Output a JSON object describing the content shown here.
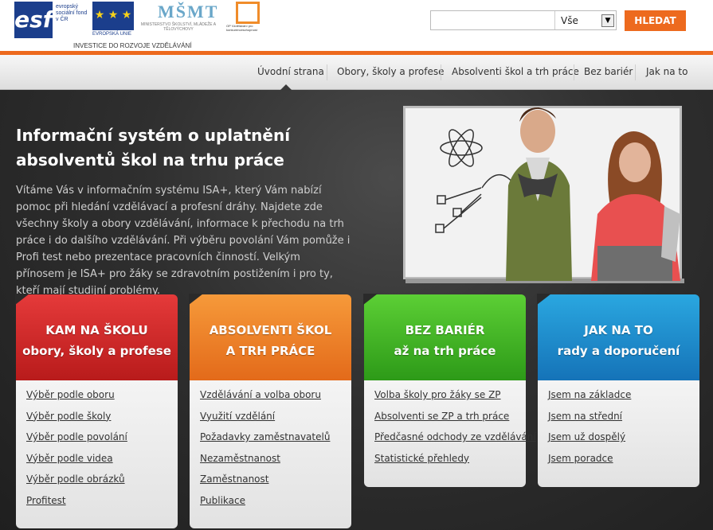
{
  "header": {
    "esf_text": "evropský sociální fond v ČR",
    "eu_caption": "EVROPSKÁ UNIE",
    "msmt_caption": "MINISTERSTVO ŠKOLSTVÍ, MLÁDEŽE A TĚLOVÝCHOVY",
    "op_caption": "OP Vzdělávání pro konkurenceschopnost",
    "invest_text": "INVESTICE DO ROZVOJE VZDĚLÁVÁNÍ",
    "search": {
      "value": "",
      "select_value": "Vše",
      "button_label": "HLEDAT"
    }
  },
  "nav": {
    "items": [
      "Úvodní strana",
      "Obory, školy a profese",
      "Absolventi škol a trh práce",
      "Bez bariér",
      "Jak na to"
    ]
  },
  "hero": {
    "title": "Informační systém o uplatnění absolventů škol na trhu práce",
    "text": "Vítáme Vás v informačním systému ISA+, který Vám nabízí pomoc při hledání vzdělávací a profesní dráhy. Najdete zde všechny školy a obory vzdělávání, informace k přechodu na trh práce i do dalšího vzdělávání. Při výběru povolání Vám pomůže i Profi test nebo prezentace pracovních činností. Velkým přínosem je ISA+ pro žáky se zdravotním postižením i pro ty, kteří mají studijní problémy."
  },
  "cards": [
    {
      "title1": "KAM NA ŠKOLU",
      "title2": "obory, školy a profese",
      "links": [
        "Výběr podle oboru",
        "Výběr podle školy",
        "Výběr podle povolání",
        "Výběr podle videa",
        "Výběr podle obrázků",
        "Profitest"
      ]
    },
    {
      "title1": "ABSOLVENTI ŠKOL",
      "title2": "A TRH PRÁCE",
      "links": [
        "Vzdělávání a volba oboru",
        "Využití vzdělání",
        "Požadavky zaměstnavatelů",
        "Nezaměstnanost",
        "Zaměstnanost",
        "Publikace"
      ]
    },
    {
      "title1": "BEZ BARIÉR",
      "title2": "až na trh práce",
      "links": [
        "Volba školy pro žáky se ZP",
        "Absolventi se ZP a trh práce",
        "Předčasné odchody ze vzdělávání",
        "Statistické přehledy"
      ]
    },
    {
      "title1": "JAK NA TO",
      "title2": "rady a doporučení",
      "links": [
        "Jsem na základce",
        "Jsem na střední",
        "Jsem už dospělý",
        "Jsem poradce"
      ]
    }
  ],
  "colors": {
    "accent": "#ed6a1e",
    "red": "#c82020",
    "orange": "#ee7a22",
    "green": "#3fb020",
    "blue": "#1e8cca"
  }
}
